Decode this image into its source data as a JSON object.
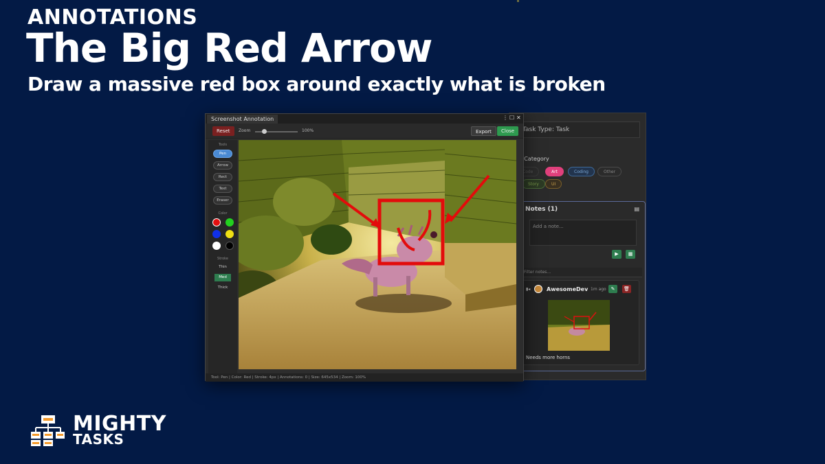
{
  "hero": {
    "kicker": "ANNOTATIONS",
    "title": "The Big Red Arrow",
    "subtitle": "Draw a massive red box around exactly what is broken"
  },
  "window": {
    "title": "Screenshot Annotation",
    "menu_icon": "⋮",
    "maximize_icon": "☐",
    "close_icon": "✕"
  },
  "toolbar": {
    "reset_label": "Reset",
    "zoom_label": "Zoom",
    "zoom_value": "100%",
    "zoom_level": 0.25,
    "export_label": "Export",
    "close_label": "Close"
  },
  "tools": {
    "heading": "Tools",
    "items": [
      "Pen",
      "Arrow",
      "Rect",
      "Text",
      "Eraser"
    ],
    "active": "Pen",
    "color_heading": "Color",
    "colors": [
      "#e31010",
      "#22d11f",
      "#1030e8",
      "#f0e014",
      "#ffffff",
      "#000000"
    ],
    "selected_color": "#e31010",
    "stroke_heading": "Stroke",
    "strokes": [
      "Thin",
      "Med",
      "Thick"
    ],
    "active_stroke": "Med"
  },
  "statusbar": {
    "text": "Tool: Pen | Color: Red | Stroke: 4px | Annotations: 0 | Size: 645x534 | Zoom: 100%"
  },
  "side": {
    "task_type": "Task Type: Task",
    "skill_label": "ill Category",
    "chips": [
      {
        "label": "Code",
        "active": false
      },
      {
        "label": "Art",
        "active": true
      },
      {
        "label": "Coding",
        "active": false
      },
      {
        "label": "Other",
        "active": false
      },
      {
        "label": "Story",
        "active": false
      },
      {
        "label": "UI",
        "active": false
      }
    ],
    "notes_title": "Notes (1)",
    "note_placeholder": "Add a note...",
    "filter_placeholder": "Filter notes...",
    "note": {
      "author": "AwesomeDev",
      "time": "1m ago",
      "text": "Needs more horns"
    }
  },
  "brand": {
    "name": "MIGHTY",
    "sub": "TASKS"
  }
}
